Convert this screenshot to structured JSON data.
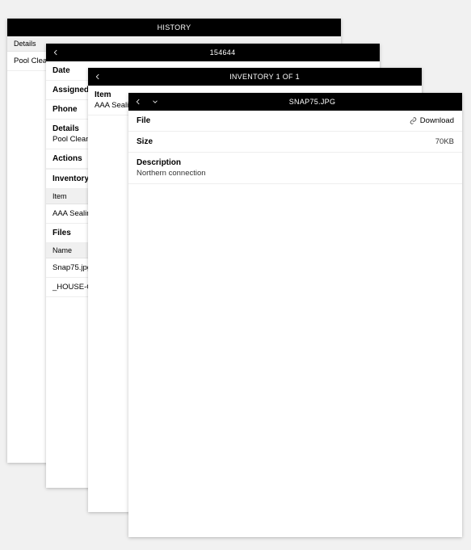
{
  "panel1": {
    "title": "HISTORY",
    "col_details": "Details",
    "row_details": "Pool Clean"
  },
  "panel2": {
    "title": "154644",
    "labels": {
      "date": "Date",
      "assigned": "Assigned",
      "phone": "Phone",
      "details": "Details",
      "details_value": "Pool Clean 1",
      "actions": "Actions",
      "inventory": "Inventory",
      "inv_col": "Item",
      "inv_row": "AAA Sealing",
      "files": "Files",
      "files_col": "Name",
      "file1": "Snap75.jpg",
      "file2": "_HOUSE-CON"
    }
  },
  "panel3": {
    "title": "INVENTORY 1 OF 1",
    "item_label": "Item",
    "item_value": "AAA Sealing"
  },
  "panel4": {
    "title": "SNAP75.JPG",
    "file_label": "File",
    "download": "Download",
    "size_label": "Size",
    "size_value": "70KB",
    "desc_label": "Description",
    "desc_value": "Northern connection"
  }
}
